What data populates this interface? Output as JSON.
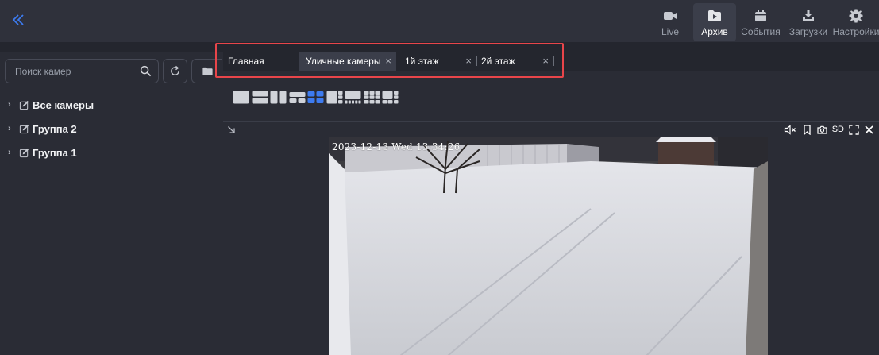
{
  "colors": {
    "accent": "#3d7bf0",
    "highlight": "#e8454a",
    "background": "#2a2c35",
    "topbar": "#2f313b"
  },
  "topbar": {
    "collapse_icon": "double-chevron-left-icon",
    "nav": [
      {
        "label": "Live",
        "icon": "video-camera-icon",
        "active": false
      },
      {
        "label": "Архив",
        "icon": "archive-folder-icon",
        "active": true
      },
      {
        "label": "События",
        "icon": "calendar-icon",
        "active": false
      },
      {
        "label": "Загрузки",
        "icon": "download-icon",
        "active": false
      },
      {
        "label": "Настройки",
        "icon": "gear-icon",
        "active": false
      }
    ]
  },
  "sidebar": {
    "search_placeholder": "Поиск камер",
    "tree": [
      {
        "label": "Все камеры"
      },
      {
        "label": "Группа 2"
      },
      {
        "label": "Группа 1"
      }
    ]
  },
  "main": {
    "tabs": [
      {
        "label": "Главная",
        "closable": false,
        "active": false
      },
      {
        "label": "Уличные камеры",
        "closable": true,
        "active": true
      },
      {
        "label": "1й этаж",
        "closable": true,
        "active": false
      },
      {
        "label": "2й этаж",
        "closable": true,
        "active": false
      }
    ],
    "close_glyph": "×",
    "active_layout_index": 4
  },
  "camera": {
    "timestamp": "2023-12-13 Wed 13:34:26",
    "stream_quality": "SD"
  }
}
